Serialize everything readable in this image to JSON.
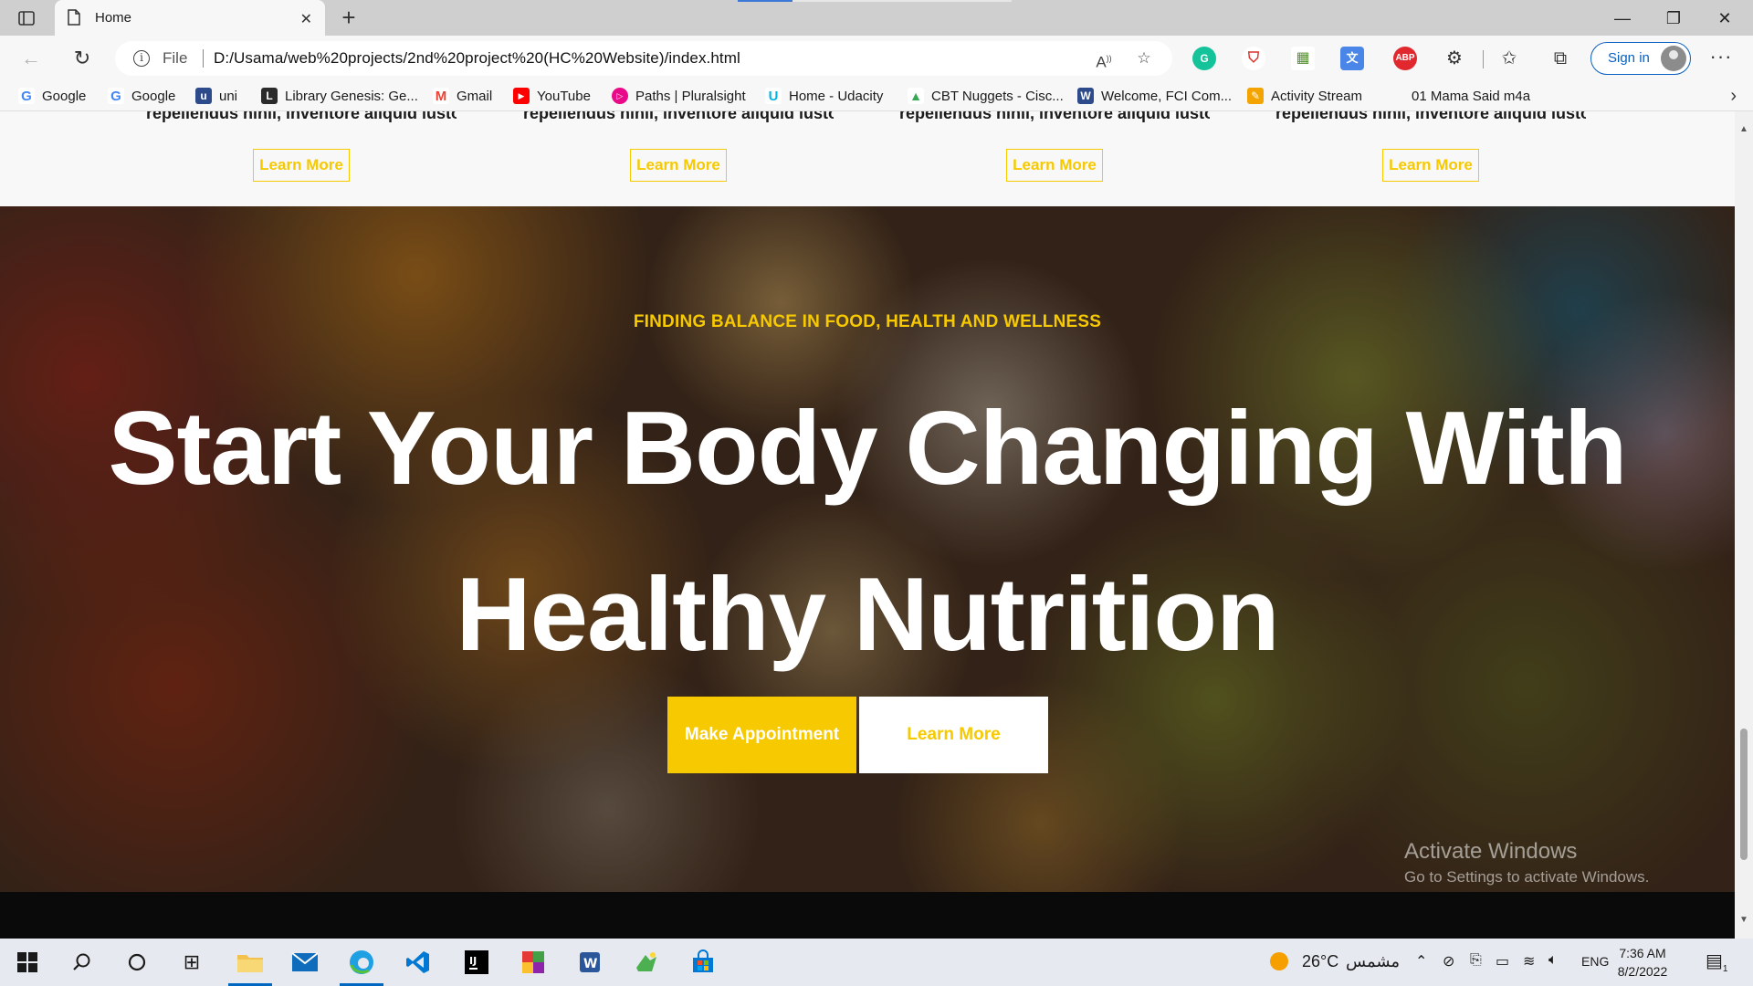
{
  "browser": {
    "tab_title": "Home",
    "file_label": "File",
    "url": "D:/Usama/web%20projects/2nd%20project%20(HC%20Website)/index.html",
    "sign_in_label": "Sign in",
    "ext_abp_label": "ABP",
    "bookmarks": [
      {
        "label": "Google",
        "icon": "google-icon",
        "color": "#4285f4",
        "glyph": "G"
      },
      {
        "label": "Google",
        "icon": "google-icon",
        "color": "#4285f4",
        "glyph": "G"
      },
      {
        "label": "uni",
        "icon": "globe-icon",
        "color": "#2d4a8a",
        "glyph": "u"
      },
      {
        "label": "Library Genesis: Ge...",
        "icon": "library-icon",
        "color": "#2b2b2b",
        "glyph": "L"
      },
      {
        "label": "Gmail",
        "icon": "gmail-icon",
        "color": "#ea4335",
        "glyph": "M"
      },
      {
        "label": "YouTube",
        "icon": "youtube-icon",
        "color": "#ff0000",
        "glyph": "▶"
      },
      {
        "label": "Paths | Pluralsight",
        "icon": "pluralsight-icon",
        "color": "#e80a89",
        "glyph": "▷"
      },
      {
        "label": "Home - Udacity",
        "icon": "udacity-icon",
        "color": "#02b3e4",
        "glyph": "U"
      },
      {
        "label": "CBT Nuggets - Cisc...",
        "icon": "drive-icon",
        "color": "#34a853",
        "glyph": "▲"
      },
      {
        "label": "Welcome, FCI Com...",
        "icon": "globe-icon",
        "color": "#2d4a8a",
        "glyph": "W"
      },
      {
        "label": "Activity Stream",
        "icon": "activity-icon",
        "color": "#f4a400",
        "glyph": "✎"
      },
      {
        "label": "01 Mama Said m4a",
        "icon": "",
        "color": "",
        "glyph": ""
      }
    ]
  },
  "page": {
    "services": [
      {
        "desc": "repellendus nihil, inventore aliquid iusto",
        "button": "Learn More"
      },
      {
        "desc": "repellendus nihil, inventore aliquid iusto",
        "button": "Learn More"
      },
      {
        "desc": "repellendus nihil, inventore aliquid iusto",
        "button": "Learn More"
      },
      {
        "desc": "repellendus nihil, inventore aliquid iusto",
        "button": "Learn More"
      }
    ],
    "hero": {
      "kicker": "FINDING BALANCE IN FOOD, HEALTH AND WELLNESS",
      "title_line1": "Start Your Body Changing With",
      "title_line2": "Healthy Nutrition",
      "primary_button": "Make Appointment",
      "secondary_button": "Learn More"
    },
    "watermark": {
      "title": "Activate Windows",
      "subtitle": "Go to Settings to activate Windows."
    }
  },
  "taskbar": {
    "weather_temp": "26°C",
    "weather_desc": "مشمس",
    "language": "ENG",
    "time": "7:36 AM",
    "date": "8/2/2022",
    "notification_count": "1"
  },
  "colors": {
    "accent": "#f6c900",
    "link_blue": "#0a5fbf"
  }
}
